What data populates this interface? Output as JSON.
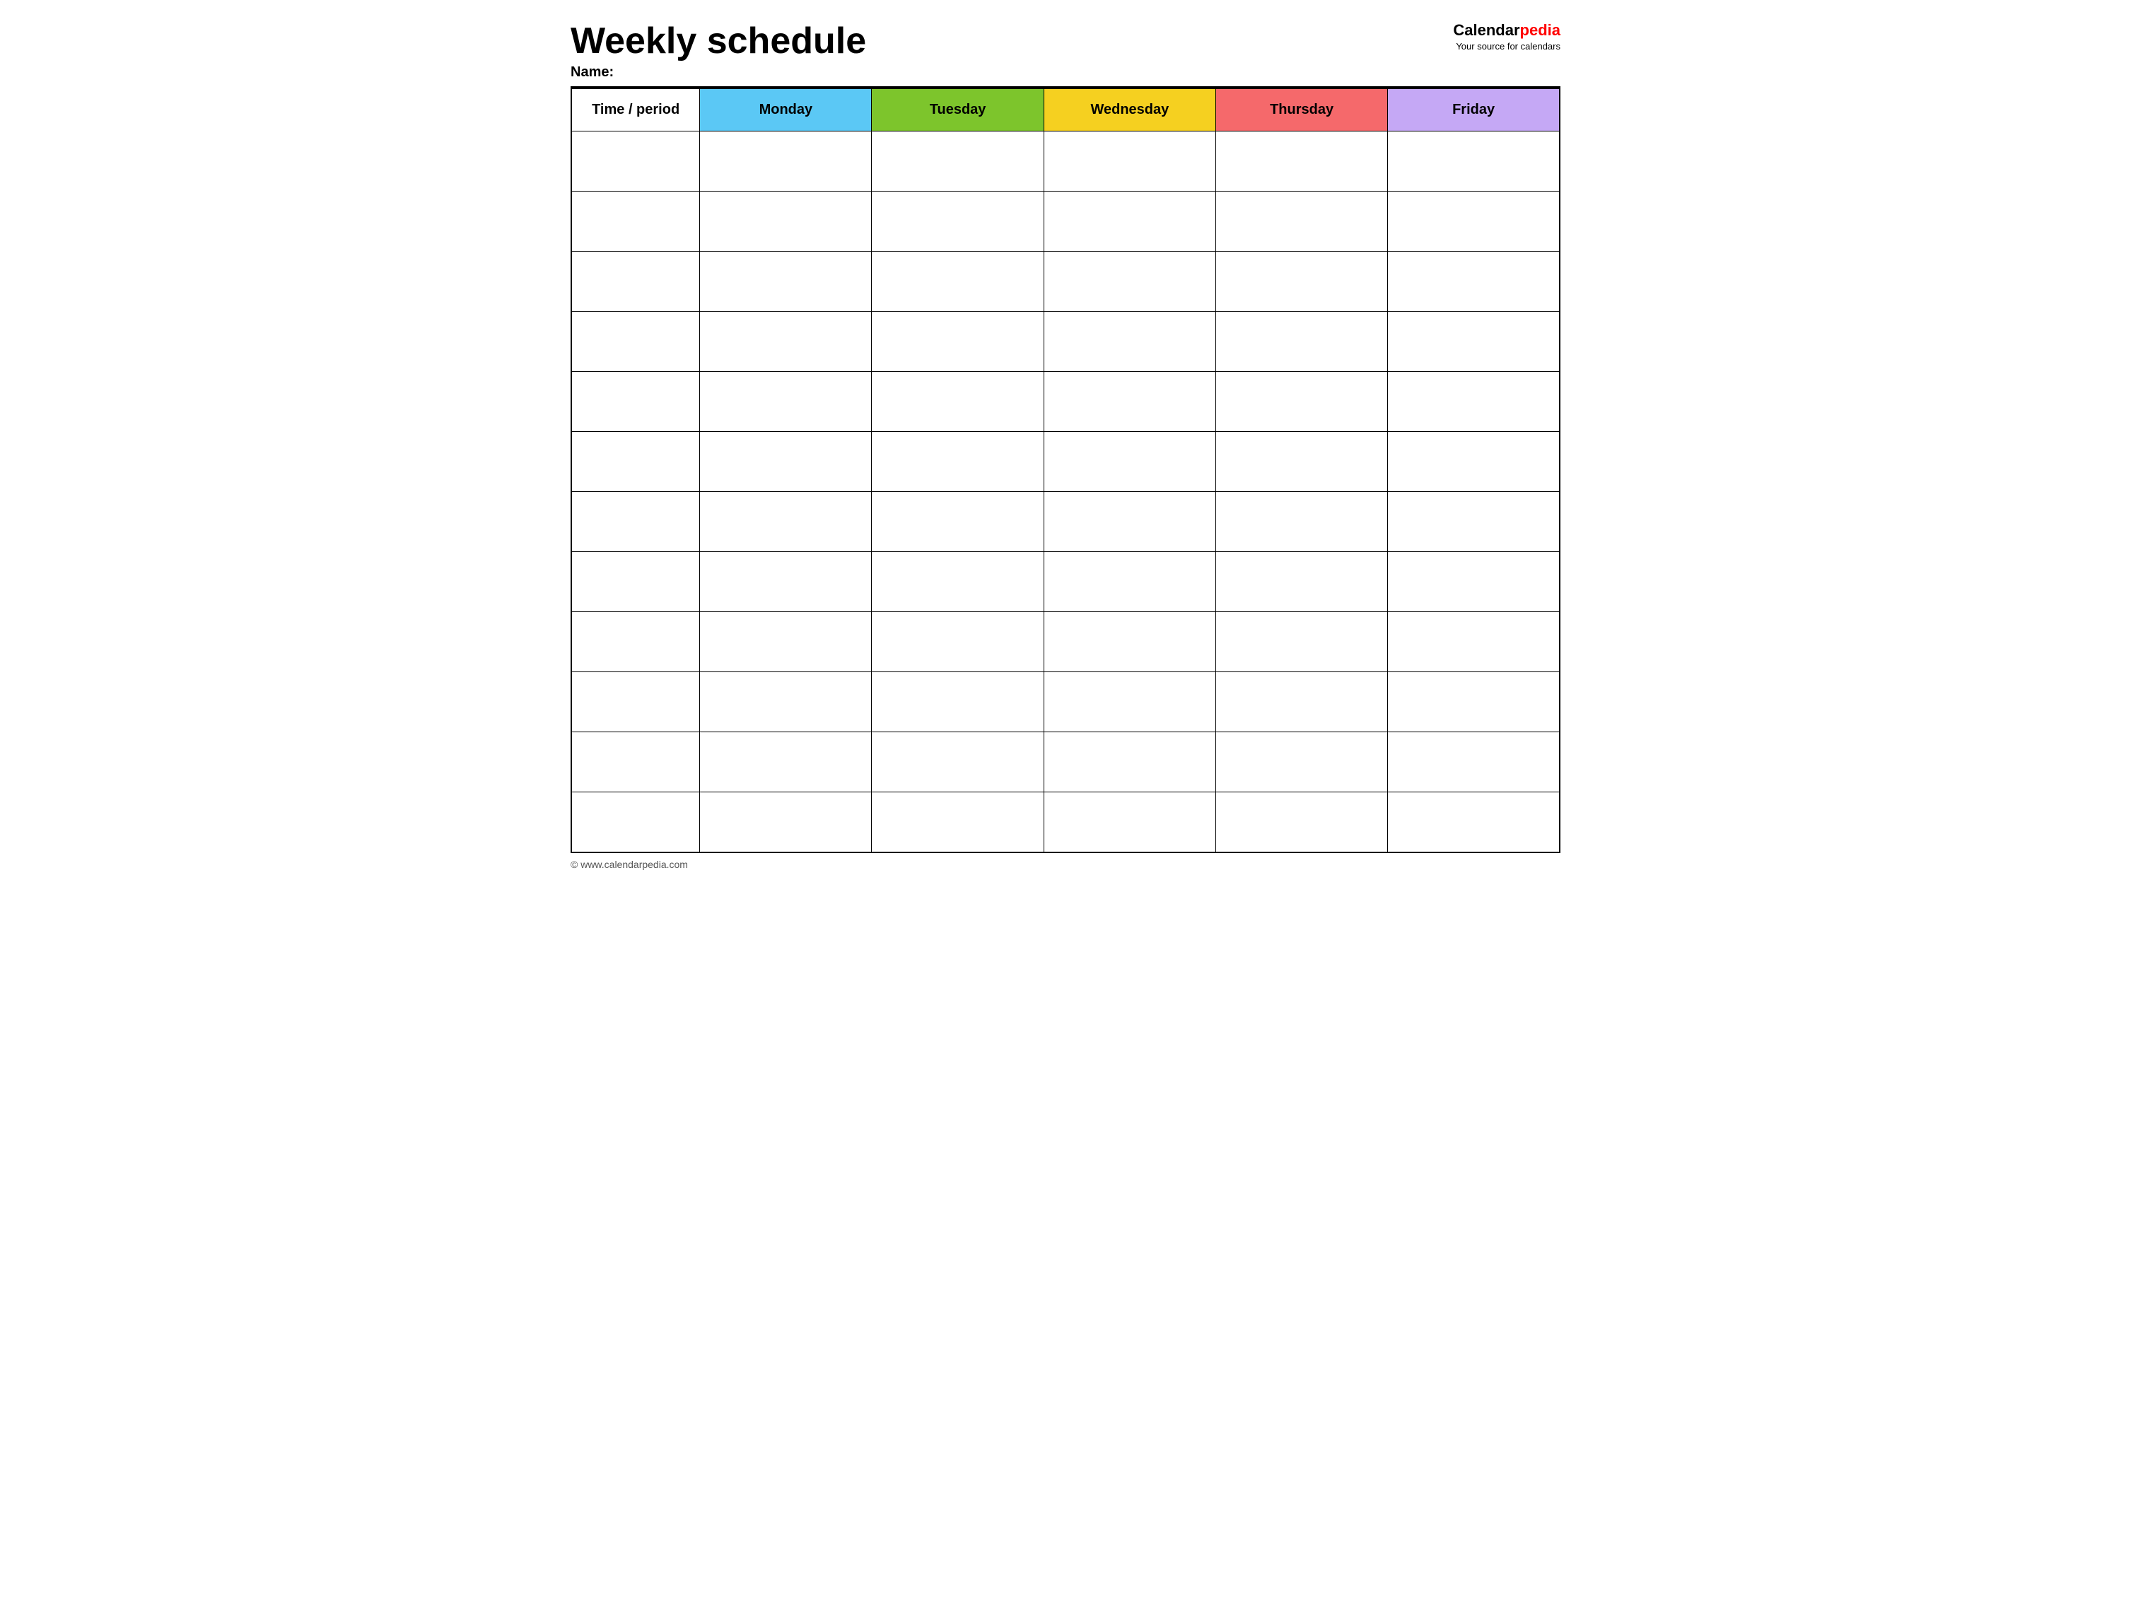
{
  "header": {
    "title": "Weekly schedule",
    "name_label": "Name:",
    "logo": {
      "calendar_text": "Calendar",
      "pedia_text": "pedia",
      "tagline": "Your source for calendars"
    }
  },
  "table": {
    "columns": [
      {
        "id": "time-period",
        "label": "Time / period",
        "color": "#ffffff"
      },
      {
        "id": "monday",
        "label": "Monday",
        "color": "#5bc8f5"
      },
      {
        "id": "tuesday",
        "label": "Tuesday",
        "color": "#7dc52c"
      },
      {
        "id": "wednesday",
        "label": "Wednesday",
        "color": "#f5d020"
      },
      {
        "id": "thursday",
        "label": "Thursday",
        "color": "#f5696b"
      },
      {
        "id": "friday",
        "label": "Friday",
        "color": "#c5a8f5"
      }
    ],
    "row_count": 12
  },
  "footer": {
    "url": "© www.calendarpedia.com"
  }
}
